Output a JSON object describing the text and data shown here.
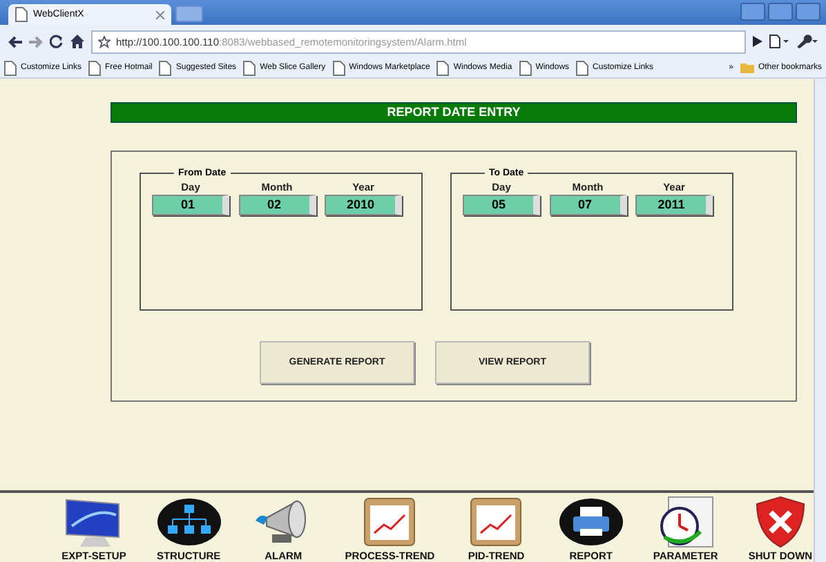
{
  "browser": {
    "tab_title": "WebClientX",
    "address": {
      "host": "http://100.100.100.110",
      "rest": ":8083/webbased_remotemonitoringsystem/Alarm.html"
    },
    "bookmarks": [
      "Customize Links",
      "Free Hotmail",
      "Suggested Sites",
      "Web Slice Gallery",
      "Windows Marketplace",
      "Windows Media",
      "Windows",
      "Customize Links"
    ],
    "overflow": "»",
    "other_bookmarks": "Other bookmarks"
  },
  "page": {
    "title": "REPORT DATE ENTRY",
    "ranges": [
      {
        "legend": "From Date",
        "fields": [
          {
            "label": "Day",
            "value": "01"
          },
          {
            "label": "Month",
            "value": "02"
          },
          {
            "label": "Year",
            "value": "2010"
          }
        ]
      },
      {
        "legend": "To Date",
        "fields": [
          {
            "label": "Day",
            "value": "05"
          },
          {
            "label": "Month",
            "value": "07"
          },
          {
            "label": "Year",
            "value": "2011"
          }
        ]
      }
    ],
    "buttons": [
      "GENERATE REPORT",
      "VIEW REPORT"
    ]
  },
  "toolbar": [
    {
      "label": "EXPT-SETUP",
      "kind": "monitor"
    },
    {
      "label": "STRUCTURE",
      "kind": "network"
    },
    {
      "label": "ALARM",
      "kind": "megaphone"
    },
    {
      "label": "PROCESS-TREND",
      "kind": "chart"
    },
    {
      "label": "PID-TREND",
      "kind": "chart"
    },
    {
      "label": "REPORT",
      "kind": "printer"
    },
    {
      "label": "PARAMETER",
      "kind": "clock"
    },
    {
      "label": "SHUT DOWN",
      "kind": "shield"
    }
  ]
}
